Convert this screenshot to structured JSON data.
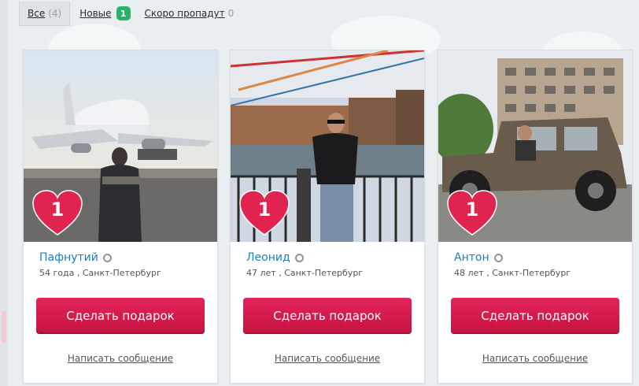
{
  "tabs": [
    {
      "label": "Все",
      "count": "(4)"
    },
    {
      "label": "Новые",
      "badge": "1"
    },
    {
      "label": "Скоро пропадут",
      "count": "0"
    }
  ],
  "cards": [
    {
      "name": "Пафнутий",
      "meta": "54 года , Санкт-Петербург",
      "hearts": "1",
      "photo": "airplane-photo"
    },
    {
      "name": "Леонид",
      "meta": "47 лет , Санкт-Петербург",
      "hearts": "1",
      "photo": "fence-photo"
    },
    {
      "name": "Антон",
      "meta": "48 лет , Санкт-Петербург",
      "hearts": "1",
      "photo": "jeep-photo"
    }
  ],
  "actions": {
    "gift_label": "Сделать подарок",
    "message_label": "Написать сообщение"
  },
  "colors": {
    "accent": "#d61b4c",
    "link": "#1c7fc2",
    "badge": "#29b36a"
  }
}
